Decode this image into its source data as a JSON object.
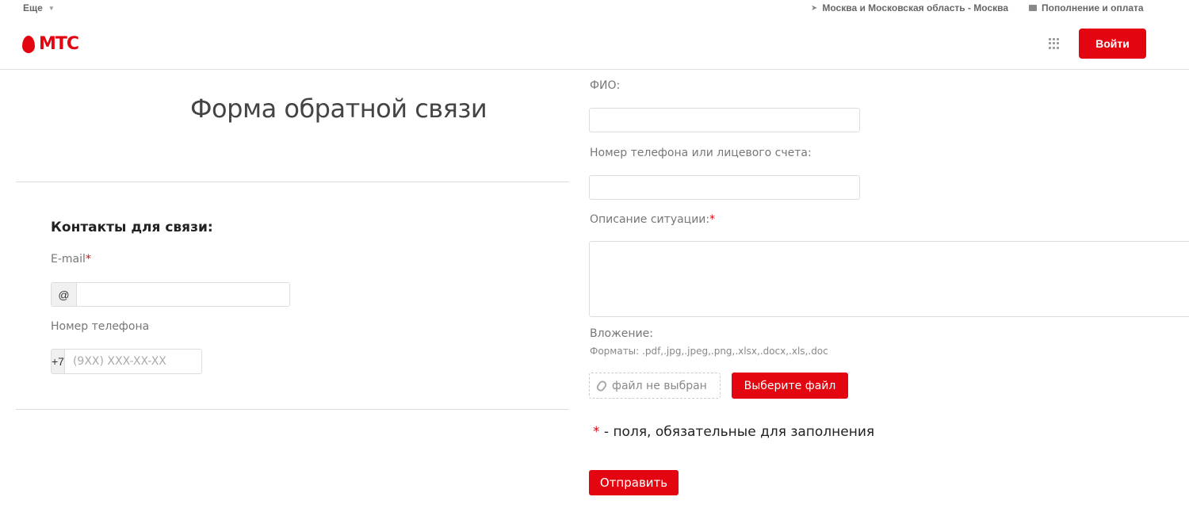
{
  "topbar": {
    "more_label": "Еще",
    "region_label": "Москва и Московская область - Москва",
    "topup_label": "Пополнение и оплата"
  },
  "header": {
    "logo_text": "МТС",
    "login_label": "Войти"
  },
  "page": {
    "title": "Форма обратной связи"
  },
  "contacts": {
    "heading": "Контакты для связи:",
    "email_label": "E-mail",
    "email_prefix": "@",
    "email_value": "",
    "phone_label": "Номер телефона",
    "phone_prefix": "+7",
    "phone_placeholder": "(9XX) XXX-XX-XX"
  },
  "form": {
    "fio_label": "ФИО:",
    "account_label": "Номер телефона или лицевого счета:",
    "description_label": "Описание ситуации:",
    "attachment_label": "Вложение:",
    "formats_text": "Форматы: .pdf,.jpg,.jpeg,.png,.xlsx,.docx,.xls,.doc",
    "no_file_text": "файл не выбран",
    "choose_file_label": "Выберите файл",
    "required_mark": "*",
    "required_note": " - поля, обязательные для заполнения",
    "submit_label": "Отправить"
  },
  "colors": {
    "brand_red": "#e30611"
  },
  "icons": {
    "region": "location-arrow-icon",
    "topup": "card-icon",
    "apps": "grid-icon",
    "attachment": "paperclip-icon"
  }
}
